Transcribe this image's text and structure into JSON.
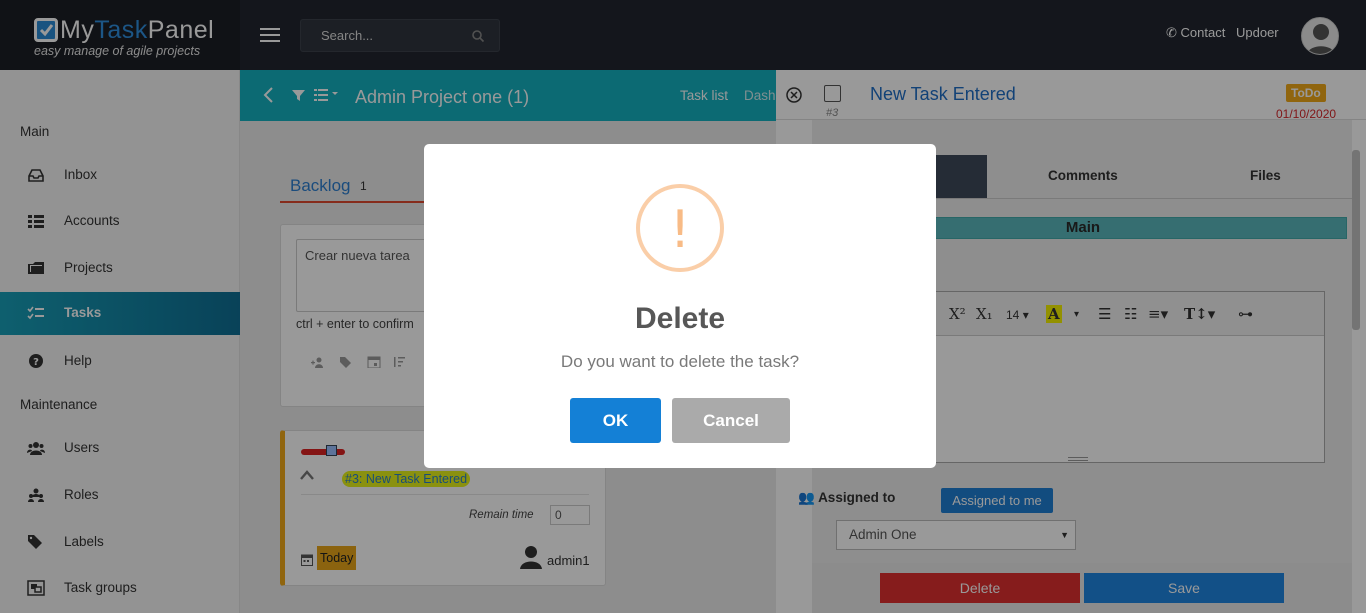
{
  "brand": {
    "name_part1": "My",
    "name_part2": "Task",
    "name_part3": "Panel",
    "tagline": "easy manage of agile projects"
  },
  "header": {
    "search_placeholder": "Search...",
    "contact_label": "Contact",
    "user_label": "Updoer"
  },
  "sidebar": {
    "section_main": "Main",
    "section_maintenance": "Maintenance",
    "items": [
      {
        "label": "Inbox",
        "icon": "inbox-icon"
      },
      {
        "label": "Accounts",
        "icon": "list-icon"
      },
      {
        "label": "Projects",
        "icon": "folder-icon"
      },
      {
        "label": "Tasks",
        "icon": "tasks-icon",
        "active": true
      },
      {
        "label": "Help",
        "icon": "help-icon"
      },
      {
        "label": "Users",
        "icon": "users-icon"
      },
      {
        "label": "Roles",
        "icon": "roles-icon"
      },
      {
        "label": "Labels",
        "icon": "tags-icon"
      },
      {
        "label": "Task groups",
        "icon": "object-group-icon"
      }
    ]
  },
  "project": {
    "title": "Admin Project one (1)",
    "tab_tasklist": "Task list",
    "tab_dash": "Dash"
  },
  "backlog": {
    "title": "Backlog",
    "count": "1",
    "new_task_placeholder": "Crear nueva tarea",
    "hint": "ctrl + enter to confirm"
  },
  "task_card": {
    "ref": "#3: New Task Entered",
    "remain_label": "Remain time",
    "remain_value": "0",
    "due": "Today",
    "user": "admin1",
    "priority_fraction": 0.7
  },
  "detail": {
    "number": "#3",
    "title": "New Task Entered",
    "status": "ToDo",
    "date": "01/10/2020",
    "tab_comments": "Comments",
    "tab_files": "Files",
    "section_main": "Main",
    "font_size": "14",
    "assigned_label": "Assigned to",
    "assigned_to_me": "Assigned to me",
    "assignee": "Admin One",
    "delete_label": "Delete",
    "save_label": "Save"
  },
  "dialog": {
    "icon": "!",
    "title": "Delete",
    "text": "Do you want to delete the task?",
    "ok_label": "OK",
    "cancel_label": "Cancel"
  },
  "colors": {
    "accent": "#15b1c0",
    "danger": "#e03030",
    "primary": "#1f86e2",
    "warning": "#f0a818"
  }
}
